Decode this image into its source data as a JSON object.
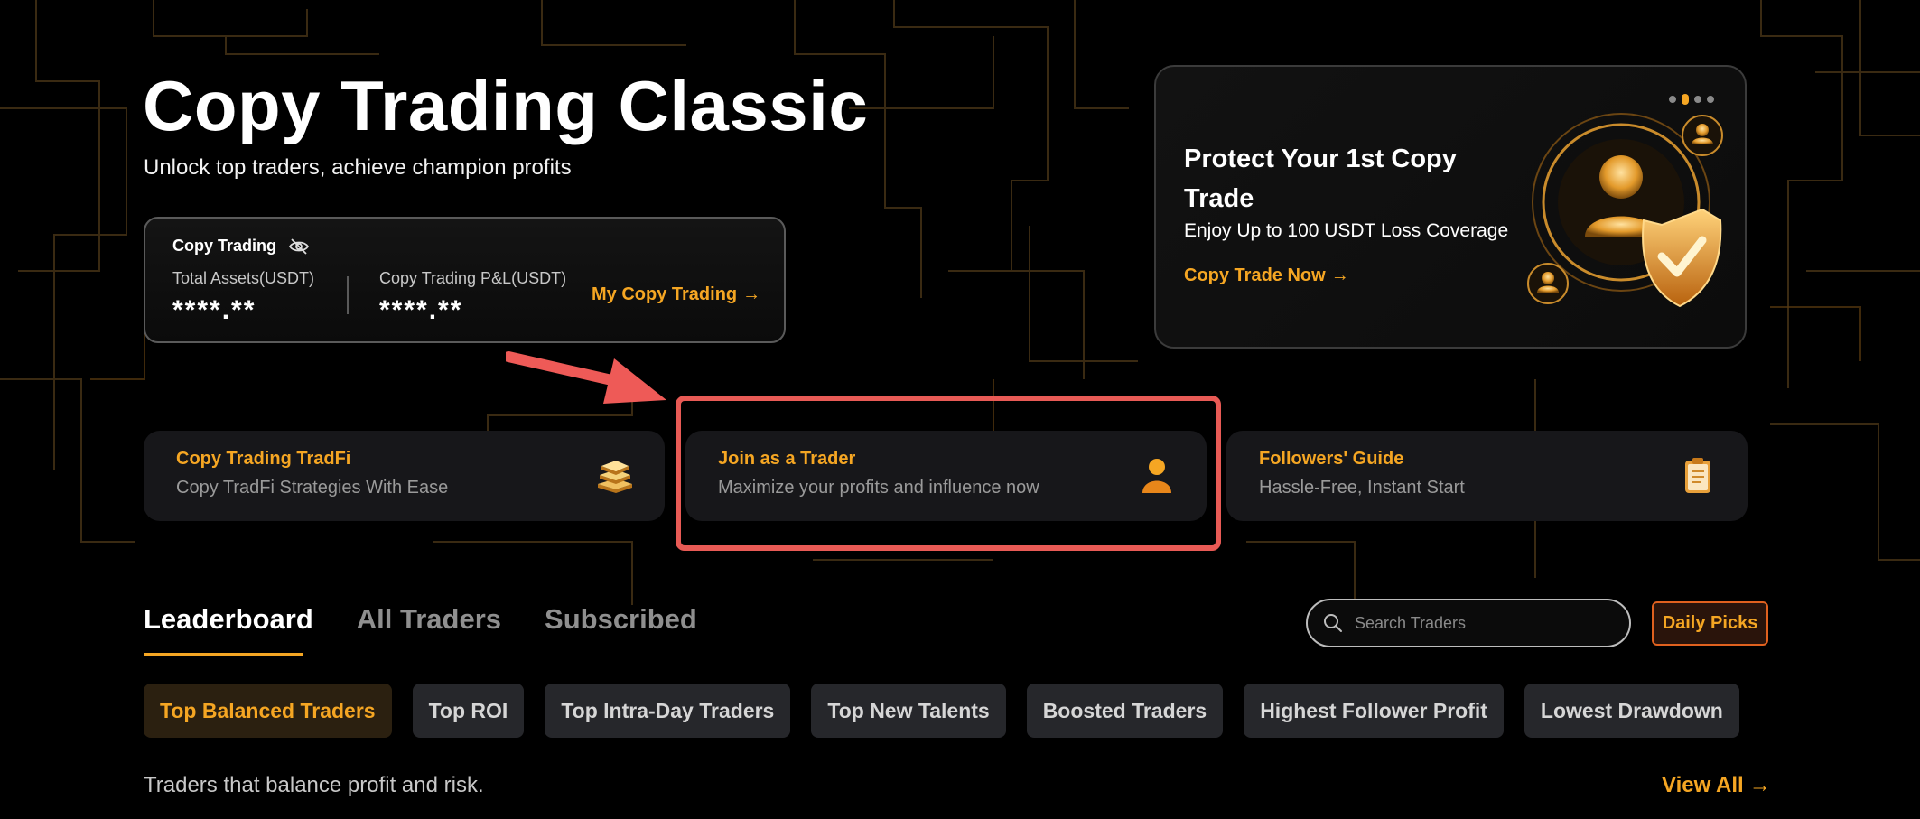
{
  "hero": {
    "title": "Copy Trading Classic",
    "subtitle": "Unlock top traders, achieve champion profits"
  },
  "assets_card": {
    "label": "Copy Trading",
    "total_assets_label": "Total Assets(USDT)",
    "total_assets_value": "****.**",
    "pnl_label": "Copy Trading P&L(USDT)",
    "pnl_value": "****.**",
    "link_label": "My Copy Trading"
  },
  "promo": {
    "title": "Protect Your 1st Copy Trade",
    "description": "Enjoy Up to 100 USDT Loss Coverage",
    "cta_label": "Copy Trade Now",
    "carousel_count": 4,
    "carousel_active": 2
  },
  "features": [
    {
      "title": "Copy Trading TradFi",
      "subtitle": "Copy TradFi Strategies With Ease",
      "icon": "gold-bars-icon"
    },
    {
      "title": "Join as a Trader",
      "subtitle": "Maximize your profits and influence now",
      "icon": "trader-person-icon"
    },
    {
      "title": "Followers' Guide",
      "subtitle": "Hassle-Free, Instant Start",
      "icon": "clipboard-icon"
    }
  ],
  "tabs": [
    {
      "label": "Leaderboard",
      "active": true
    },
    {
      "label": "All Traders",
      "active": false
    },
    {
      "label": "Subscribed",
      "active": false
    }
  ],
  "search": {
    "placeholder": "Search Traders"
  },
  "daily_picks_label": "Daily Picks",
  "chips": [
    {
      "label": "Top Balanced Traders",
      "active": true
    },
    {
      "label": "Top ROI",
      "active": false
    },
    {
      "label": "Top Intra-Day Traders",
      "active": false
    },
    {
      "label": "Top New Talents",
      "active": false
    },
    {
      "label": "Boosted Traders",
      "active": false
    },
    {
      "label": "Highest Follower Profit",
      "active": false
    },
    {
      "label": "Lowest Drawdown",
      "active": false
    }
  ],
  "caption": "Traders that balance profit and risk.",
  "view_all_label": "View All",
  "colors": {
    "accent": "#f5a623",
    "highlight": "#e85a55",
    "background": "#000000",
    "card": "#17171a"
  }
}
